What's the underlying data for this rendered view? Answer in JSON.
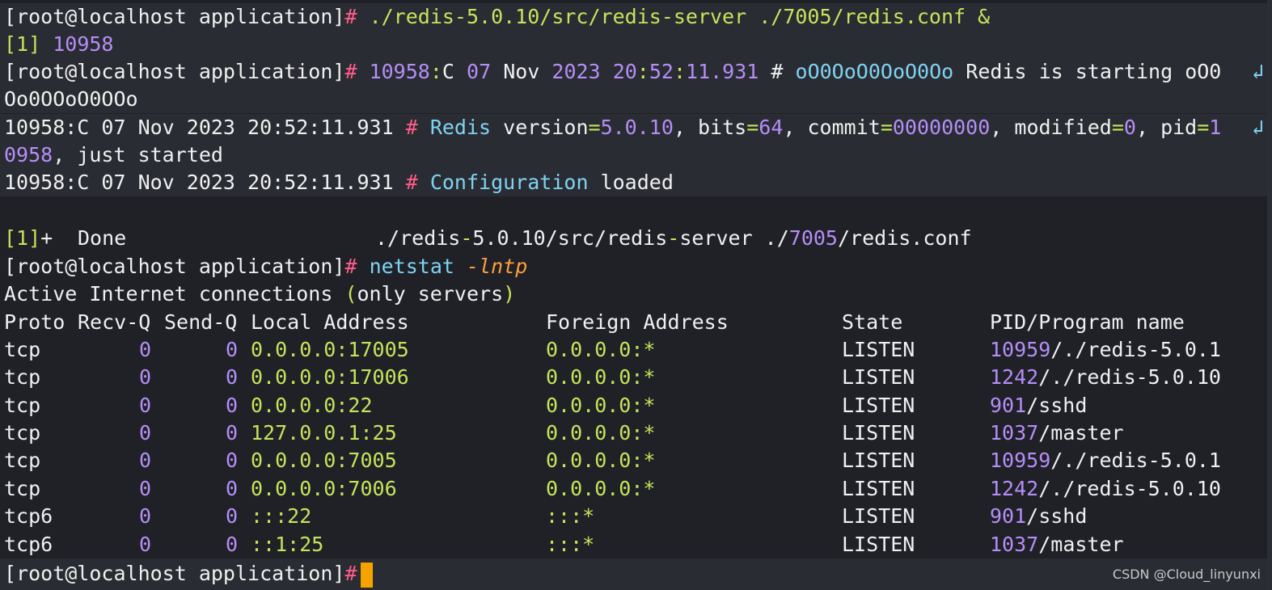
{
  "prompt": "[root@localhost application]",
  "prompt_hash": "#",
  "cmd1": {
    "a": "./redis-5.0.10/src/redis-server",
    "b": "./7005/redis.conf",
    "c": "&"
  },
  "job_line": {
    "job": "[1]",
    "pid": "10958"
  },
  "log1": {
    "pid": "10958",
    "colon": ":",
    "role": "C",
    "day": "07",
    "mon": "Nov",
    "year": "2023",
    "hh": "20",
    "mm": "52",
    "ss": "11.931",
    "hash": "#",
    "o1": "oO0OoO0OoO0Oo",
    "msg": "Redis is starting oO0",
    "cont": "Oo0OOoO0OOo"
  },
  "log2": {
    "prefix": "10958:C 07 Nov 2023 20:52:11.931",
    "hash": "#",
    "redis": "Redis",
    "version_key": "version",
    "version_val": "5.0.10",
    "bits_key": "bits",
    "bits_val": "64",
    "commit_key": "commit",
    "commit_val": "00000000",
    "modified_key": "modified",
    "modified_val": "0",
    "pid_key": "pid",
    "pid_val_a": "1",
    "pid_val_b": "0958",
    "tail": ", just started"
  },
  "log3": {
    "prefix": "10958:C 07 Nov 2023 20:52:11.931",
    "hash": "#",
    "config": "Configuration",
    "loaded": "loaded"
  },
  "done_line": {
    "job": "[1]",
    "plus": "+",
    "done": "Done",
    "path_a": "./redis",
    "path_b": "5.0.10",
    "path_c": "/src/redis",
    "path_d": "server ./",
    "path_e": "7005",
    "path_f": "/redis.conf"
  },
  "netstat_cmd": {
    "cmd": "netstat",
    "flag": "-lntp"
  },
  "netstat_title": {
    "a": "Active Internet connections ",
    "b": "(",
    "c": "only servers",
    "d": ")"
  },
  "netstat_header": {
    "proto": "Proto",
    "recvq": "Recv-Q",
    "sendq": "Send-Q",
    "local": "Local Address",
    "foreign": "Foreign Address",
    "state": "State",
    "pid": "PID/Program name"
  },
  "netstat_rows": [
    {
      "proto": "tcp",
      "recv": "0",
      "send": "0",
      "local": "0.0.0.0:17005",
      "foreign": "0.0.0.0:*",
      "state": "LISTEN",
      "pid": "10959",
      "prog": "/./redis-5.0.1"
    },
    {
      "proto": "tcp",
      "recv": "0",
      "send": "0",
      "local": "0.0.0.0:17006",
      "foreign": "0.0.0.0:*",
      "state": "LISTEN",
      "pid": "1242",
      "prog": "/./redis-5.0.10"
    },
    {
      "proto": "tcp",
      "recv": "0",
      "send": "0",
      "local": "0.0.0.0:22",
      "foreign": "0.0.0.0:*",
      "state": "LISTEN",
      "pid": "901",
      "prog": "/sshd"
    },
    {
      "proto": "tcp",
      "recv": "0",
      "send": "0",
      "local": "127.0.0.1:25",
      "foreign": "0.0.0.0:*",
      "state": "LISTEN",
      "pid": "1037",
      "prog": "/master"
    },
    {
      "proto": "tcp",
      "recv": "0",
      "send": "0",
      "local": "0.0.0.0:7005",
      "foreign": "0.0.0.0:*",
      "state": "LISTEN",
      "pid": "10959",
      "prog": "/./redis-5.0.1"
    },
    {
      "proto": "tcp",
      "recv": "0",
      "send": "0",
      "local": "0.0.0.0:7006",
      "foreign": "0.0.0.0:*",
      "state": "LISTEN",
      "pid": "1242",
      "prog": "/./redis-5.0.10"
    },
    {
      "proto": "tcp6",
      "recv": "0",
      "send": "0",
      "local": ":::22",
      "foreign": ":::*",
      "state": "LISTEN",
      "pid": "901",
      "prog": "/sshd"
    },
    {
      "proto": "tcp6",
      "recv": "0",
      "send": "0",
      "local": "::1:25",
      "foreign": ":::*",
      "state": "LISTEN",
      "pid": "1037",
      "prog": "/master"
    }
  ],
  "wrap_glyph": "↲",
  "watermark": "CSDN @Cloud_linyunxi",
  "colors": {
    "background": "#1f2127",
    "highlight": "#2a2c33",
    "hash": "#ff5c8a",
    "green": "#c7e35a",
    "purple": "#b58ef7",
    "cyan": "#7fd3f2",
    "orange": "#ff9e3d",
    "cursor": "#f6a300"
  }
}
